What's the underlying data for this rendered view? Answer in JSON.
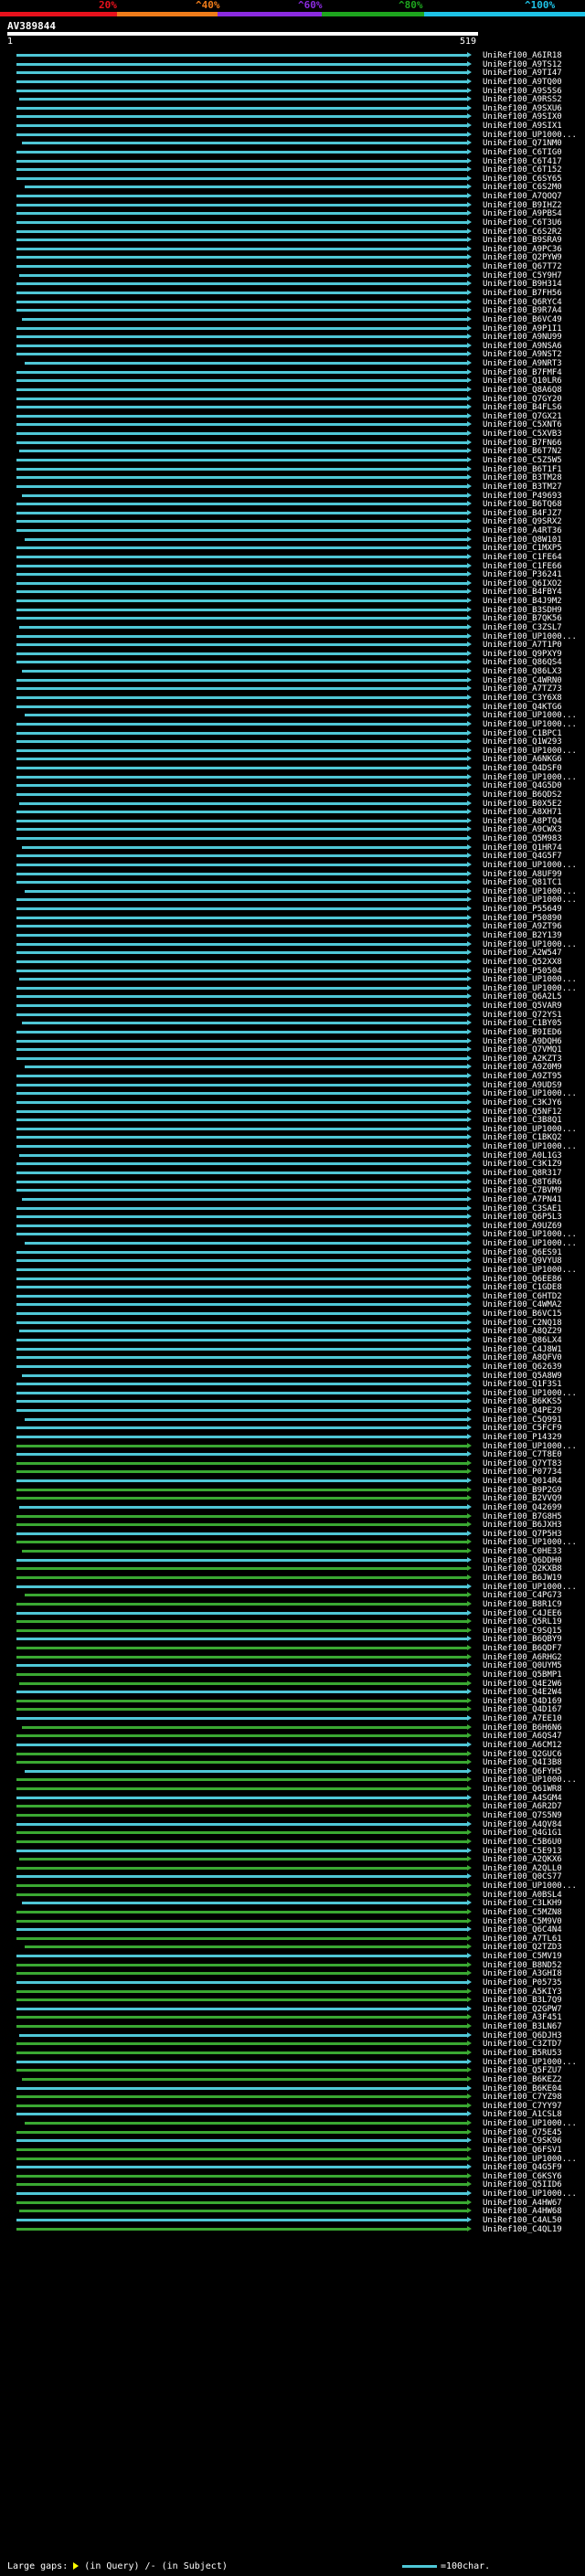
{
  "scale_ticks": [
    "20%",
    "^40%",
    "^60%",
    "^80%",
    "^100%"
  ],
  "scale_colors": [
    "#e8111c",
    "#f07c1a",
    "#8b2be0",
    "#1ea51e",
    "#1ec2e6"
  ],
  "query_id": "AV389844",
  "query_start": "1",
  "query_end": "519",
  "hit_colors": {
    "high": "#4fc7d6",
    "mid": "#3aa832"
  },
  "hits": [
    "UniRef100_A6IR18",
    "UniRef100_A9TS12",
    "UniRef100_A9TI47",
    "UniRef100_A9TQ00",
    "UniRef100_A9S5S6",
    "UniRef100_A9RSS2",
    "UniRef100_A9SXU6",
    "UniRef100_A9SIX0",
    "UniRef100_A9SIX1",
    "UniRef100_UP1000...",
    "UniRef100_Q71NM0",
    "UniRef100_C6TIG0",
    "UniRef100_C6T417",
    "UniRef100_C6T152",
    "UniRef100_C6SY65",
    "UniRef100_C6S2M0",
    "UniRef100_A7QOQ7",
    "UniRef100_B9IHZ2",
    "UniRef100_A9PBS4",
    "UniRef100_C6T3U6",
    "UniRef100_C6S2R2",
    "UniRef100_B9SRA9",
    "UniRef100_A9PC36",
    "UniRef100_Q2PYW9",
    "UniRef100_Q67T72",
    "UniRef100_C5Y9H7",
    "UniRef100_B9H314",
    "UniRef100_B7FH56",
    "UniRef100_Q6RYC4",
    "UniRef100_B9R7A4",
    "UniRef100_B6VC49",
    "UniRef100_A9P1I1",
    "UniRef100_A9NU99",
    "UniRef100_A9NSA6",
    "UniRef100_A9NST2",
    "UniRef100_A9NRT3",
    "UniRef100_B7FMF4",
    "UniRef100_Q10LR6",
    "UniRef100_Q8A6Q8",
    "UniRef100_Q7GY20",
    "UniRef100_B4FLS6",
    "UniRef100_Q7GX21",
    "UniRef100_C5XNT6",
    "UniRef100_C5XVB3",
    "UniRef100_B7FN66",
    "UniRef100_B6T7N2",
    "UniRef100_C5Z5W5",
    "UniRef100_B6T1F1",
    "UniRef100_B3TM28",
    "UniRef100_B3TM27",
    "UniRef100_P49693",
    "UniRef100_B6TQ68",
    "UniRef100_B4FJZ7",
    "UniRef100_Q9SRX2",
    "UniRef100_A4RT36",
    "UniRef100_Q8W101",
    "UniRef100_C1MXP5",
    "UniRef100_C1FE64",
    "UniRef100_C1FE66",
    "UniRef100_P36241",
    "UniRef100_Q6IXO2",
    "UniRef100_B4FBY4",
    "UniRef100_B4J9M2",
    "UniRef100_B3SDH9",
    "UniRef100_B7QK56",
    "UniRef100_C3ZSL7",
    "UniRef100_UP1000...",
    "UniRef100_A7T1P0",
    "UniRef100_Q9PXY9",
    "UniRef100_Q86QS4",
    "UniRef100_Q86LX3",
    "UniRef100_C4WRN0",
    "UniRef100_A7TZ73",
    "UniRef100_C3Y6X8",
    "UniRef100_Q4KTG6",
    "UniRef100_UP1000...",
    "UniRef100_UP1000...",
    "UniRef100_C1BPC1",
    "UniRef100_Q1W293",
    "UniRef100_UP1000...",
    "UniRef100_A6NKG6",
    "UniRef100_Q4DSF0",
    "UniRef100_UP1000...",
    "UniRef100_Q4G5D0",
    "UniRef100_B6QDS2",
    "UniRef100_B0X5E2",
    "UniRef100_A8XH71",
    "UniRef100_A8PTQ4",
    "UniRef100_A9CWX3",
    "UniRef100_Q5M983",
    "UniRef100_Q1HR74",
    "UniRef100_Q4G5F7",
    "UniRef100_UP1000...",
    "UniRef100_A8UF99",
    "UniRef100_Q81TC1",
    "UniRef100_UP1000...",
    "UniRef100_UP1000...",
    "UniRef100_P55649",
    "UniRef100_P50890",
    "UniRef100_A9ZT96",
    "UniRef100_B2Y139",
    "UniRef100_UP1000...",
    "UniRef100_A2W547",
    "UniRef100_Q52XX8",
    "UniRef100_P50504",
    "UniRef100_UP1000...",
    "UniRef100_UP1000...",
    "UniRef100_Q6A2L5",
    "UniRef100_Q5VAR9",
    "UniRef100_Q72YS1",
    "UniRef100_C1BY05",
    "UniRef100_B9IED6",
    "UniRef100_A9DQH6",
    "UniRef100_Q7VMQ1",
    "UniRef100_A2KZT3",
    "UniRef100_A9Z0M9",
    "UniRef100_A9ZT95",
    "UniRef100_A9UDS9",
    "UniRef100_UP1000...",
    "UniRef100_C3KJY6",
    "UniRef100_Q5NF12",
    "UniRef100_C3B8Q1",
    "UniRef100_UP1000...",
    "UniRef100_C1BKQ2",
    "UniRef100_UP1000...",
    "UniRef100_A0L1G3",
    "UniRef100_C3K1Z9",
    "UniRef100_Q8R317",
    "UniRef100_Q8T6R6",
    "UniRef100_C7BVM9",
    "UniRef100_A7PN41",
    "UniRef100_C3SAE1",
    "UniRef100_Q6P5L3",
    "UniRef100_A9UZ69",
    "UniRef100_UP1000...",
    "UniRef100_UP1000...",
    "UniRef100_Q6ES91",
    "UniRef100_Q9VYU8",
    "UniRef100_UP1000...",
    "UniRef100_Q6EE86",
    "UniRef100_C1GDE8",
    "UniRef100_C6HTD2",
    "UniRef100_C4WMA2",
    "UniRef100_B6VC15",
    "UniRef100_C2NQ18",
    "UniRef100_A8QZ29",
    "UniRef100_Q86LX4",
    "UniRef100_C4J8W1",
    "UniRef100_A8QFV0",
    "UniRef100_Q62639",
    "UniRef100_Q5A8W9",
    "UniRef100_Q1F3S1",
    "UniRef100_UP1000...",
    "UniRef100_B6KKS5",
    "UniRef100_Q4PE29",
    "UniRef100_C5Q991",
    "UniRef100_C5FCF9",
    "UniRef100_P14329",
    "UniRef100_UP1000...",
    "UniRef100_C7T8E0",
    "UniRef100_Q7YT83",
    "UniRef100_P07734",
    "UniRef100_Q014R4",
    "UniRef100_B9P2G9",
    "UniRef100_B2VVQ9",
    "UniRef100_Q42699",
    "UniRef100_B7G8H5",
    "UniRef100_B6JXH3",
    "UniRef100_Q7P5H3",
    "UniRef100_UP1000...",
    "UniRef100_C0HE33",
    "UniRef100_Q6DDH0",
    "UniRef100_Q2KXB8",
    "UniRef100_B6JW19",
    "UniRef100_UP1000...",
    "UniRef100_C4PG73",
    "UniRef100_B8R1C9",
    "UniRef100_C4JEE6",
    "UniRef100_Q5RL19",
    "UniRef100_C9SQ15",
    "UniRef100_B6QBY9",
    "UniRef100_B6QDF7",
    "UniRef100_A6RHG2",
    "UniRef100_Q0UYM5",
    "UniRef100_Q5BMP1",
    "UniRef100_Q4E2W6",
    "UniRef100_Q4E2W4",
    "UniRef100_Q4D169",
    "UniRef100_Q4D167",
    "UniRef100_A7EE10",
    "UniRef100_B6H6N6",
    "UniRef100_A6QS47",
    "UniRef100_A6CM12",
    "UniRef100_Q2GUC6",
    "UniRef100_Q4I3B8",
    "UniRef100_Q6FYH5",
    "UniRef100_UP1000...",
    "UniRef100_Q61WR8",
    "UniRef100_A4SGM4",
    "UniRef100_A6R2D7",
    "UniRef100_Q7S5N9",
    "UniRef100_A4QV84",
    "UniRef100_Q4G1G1",
    "UniRef100_C5B6U0",
    "UniRef100_C5E913",
    "UniRef100_A2QKX6",
    "UniRef100_A2QLL0",
    "UniRef100_Q0CS77",
    "UniRef100_UP1000...",
    "UniRef100_A0BSL4",
    "UniRef100_C3LKH9",
    "UniRef100_C5MZN8",
    "UniRef100_C5M9V0",
    "UniRef100_Q6C4N4",
    "UniRef100_A7TL61",
    "UniRef100_Q2TZD3",
    "UniRef100_C5MV19",
    "UniRef100_B8ND52",
    "UniRef100_A3GHI8",
    "UniRef100_P05735",
    "UniRef100_A5KIY3",
    "UniRef100_B3L7Q9",
    "UniRef100_Q2GPW7",
    "UniRef100_A3F451",
    "UniRef100_B3LN67",
    "UniRef100_Q6DJH3",
    "UniRef100_C3ZTD7",
    "UniRef100_B5RU53",
    "UniRef100_UP1000...",
    "UniRef100_Q5FZU7",
    "UniRef100_B6KEZ2",
    "UniRef100_B6KE04",
    "UniRef100_C7YZ98",
    "UniRef100_C7YY97",
    "UniRef100_A1CSL8",
    "UniRef100_UP1000...",
    "UniRef100_Q75E45",
    "UniRef100_C9SK96",
    "UniRef100_Q6FSV1",
    "UniRef100_UP1000...",
    "UniRef100_Q4G5F9",
    "UniRef100_C6KSY6",
    "UniRef100_Q5IID6",
    "UniRef100_UP1000...",
    "UniRef100_A4HW67",
    "UniRef100_A4HW68",
    "UniRef100_C4AL50",
    "UniRef100_C4QL19"
  ],
  "legend_text": "Large gaps:",
  "legend_query": "(in Query)",
  "legend_subject": "(in Subject)",
  "legend_scale": "=100char."
}
